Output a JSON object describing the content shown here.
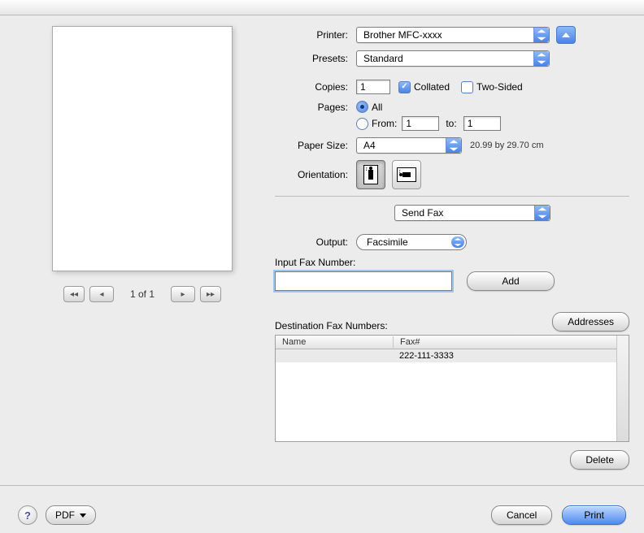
{
  "preview": {
    "page_indicator": "1 of 1"
  },
  "printer": {
    "label": "Printer:",
    "value": "Brother MFC-xxxx"
  },
  "presets": {
    "label": "Presets:",
    "value": "Standard"
  },
  "copies": {
    "label": "Copies:",
    "value": "1",
    "collated_label": "Collated",
    "collated_checked": true,
    "twosided_label": "Two-Sided",
    "twosided_checked": false
  },
  "pages": {
    "label": "Pages:",
    "all_label": "All",
    "all_selected": true,
    "from_label": "From:",
    "from_value": "1",
    "to_label": "to:",
    "to_value": "1"
  },
  "paper": {
    "label": "Paper Size:",
    "value": "A4",
    "dim": "20.99 by 29.70 cm"
  },
  "orientation": {
    "label": "Orientation:"
  },
  "section_select": {
    "value": "Send Fax"
  },
  "output": {
    "label": "Output:",
    "value": "Facsimile"
  },
  "fax_input": {
    "label": "Input Fax Number:",
    "value": "",
    "add_label": "Add"
  },
  "dest": {
    "label": "Destination Fax Numbers:",
    "addresses_label": "Addresses",
    "columns": {
      "name": "Name",
      "fax": "Fax#"
    },
    "rows": [
      {
        "name": "",
        "fax": "222-111-3333"
      }
    ],
    "delete_label": "Delete"
  },
  "footer": {
    "pdf_label": "PDF",
    "cancel_label": "Cancel",
    "print_label": "Print"
  }
}
